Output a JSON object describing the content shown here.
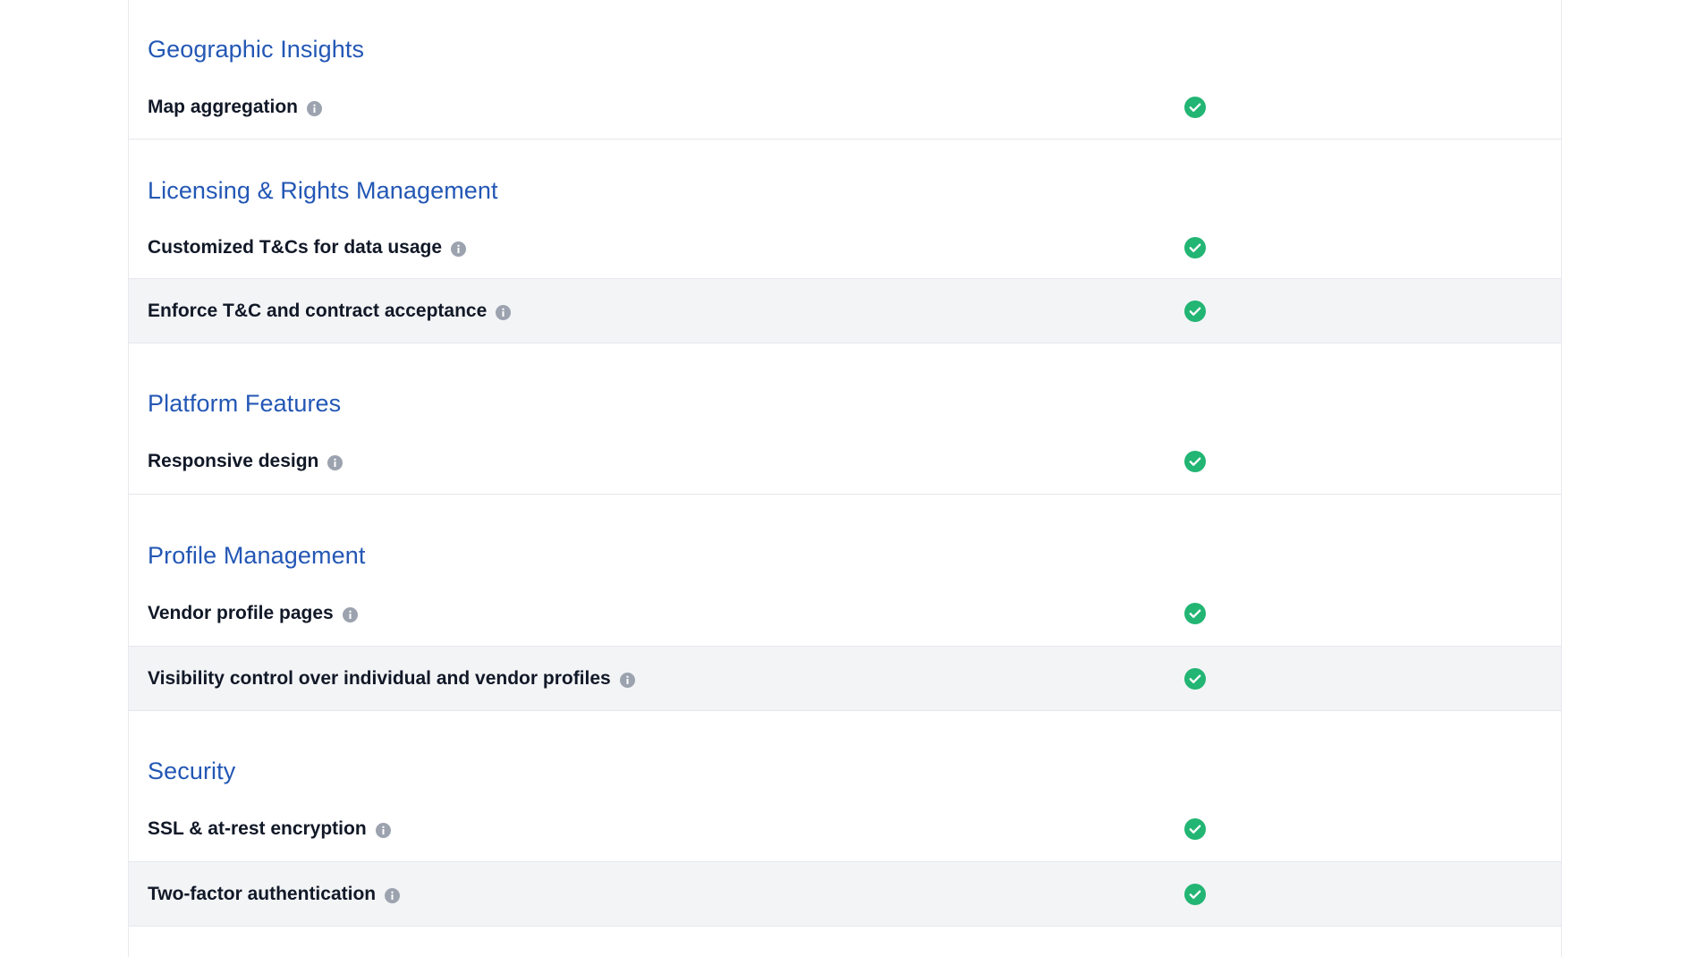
{
  "colors": {
    "section_title": "#2357b5",
    "check": "#22b573",
    "info": "#9ca3af",
    "alt_row": "#f3f4f6"
  },
  "sections": [
    {
      "title": "Geographic Insights",
      "rows": [
        {
          "label": "Map aggregation",
          "included": true,
          "icon": "info-icon"
        }
      ]
    },
    {
      "title": "Licensing & Rights Management",
      "rows": [
        {
          "label": "Customized T&Cs for data usage",
          "included": true,
          "icon": "info-icon"
        },
        {
          "label": "Enforce T&C and contract acceptance",
          "included": true,
          "icon": "info-icon"
        }
      ]
    },
    {
      "title": "Platform Features",
      "rows": [
        {
          "label": "Responsive design",
          "included": true,
          "icon": "info-icon"
        }
      ]
    },
    {
      "title": "Profile Management",
      "rows": [
        {
          "label": "Vendor profile pages",
          "included": true,
          "icon": "info-icon"
        },
        {
          "label": "Visibility control over individual and vendor profiles",
          "included": true,
          "icon": "info-icon"
        }
      ]
    },
    {
      "title": "Security",
      "rows": [
        {
          "label": "SSL & at-rest encryption",
          "included": true,
          "icon": "info-icon"
        },
        {
          "label": "Two-factor authentication",
          "included": true,
          "icon": "info-icon"
        }
      ]
    }
  ]
}
